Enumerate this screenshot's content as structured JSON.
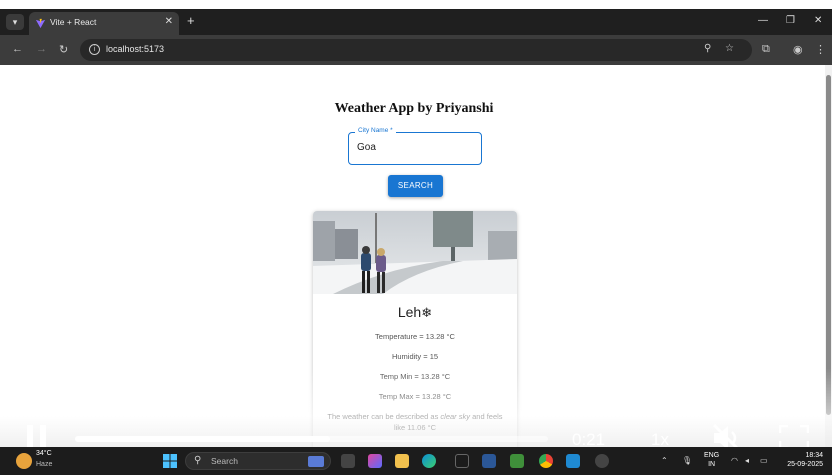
{
  "browser": {
    "tab_title": "Vite + React",
    "url": "localhost:5173"
  },
  "app": {
    "title": "Weather App by Priyanshi",
    "city_field": {
      "label": "City Name *",
      "value": "Goa"
    },
    "search_button": "SEARCH"
  },
  "card": {
    "city": "Leh",
    "weather_icon": "snowflake-icon",
    "temperature": "Temperature = 13.28 °C",
    "humidity": "Humidity = 15",
    "temp_min": "Temp Min = 13.28 °C",
    "temp_max": "Temp Max = 13.28 °C",
    "description_prefix": "The weather can be described as",
    "description_condition": "clear sky",
    "description_suffix": "and feels like 11.06 °C"
  },
  "video": {
    "time": "0:21",
    "speed": "1x",
    "progress": 0.54,
    "muted": true
  },
  "taskbar": {
    "weather_temp": "34°C",
    "weather_condition": "Haze",
    "search_placeholder": "Search",
    "language": "ENG",
    "region": "IN",
    "time": "18:34",
    "date": "25-09-2025"
  },
  "colors": {
    "accent": "#1976d2",
    "chrome_dark": "#1f1f1f",
    "chrome_bar": "#3c3c3c"
  }
}
